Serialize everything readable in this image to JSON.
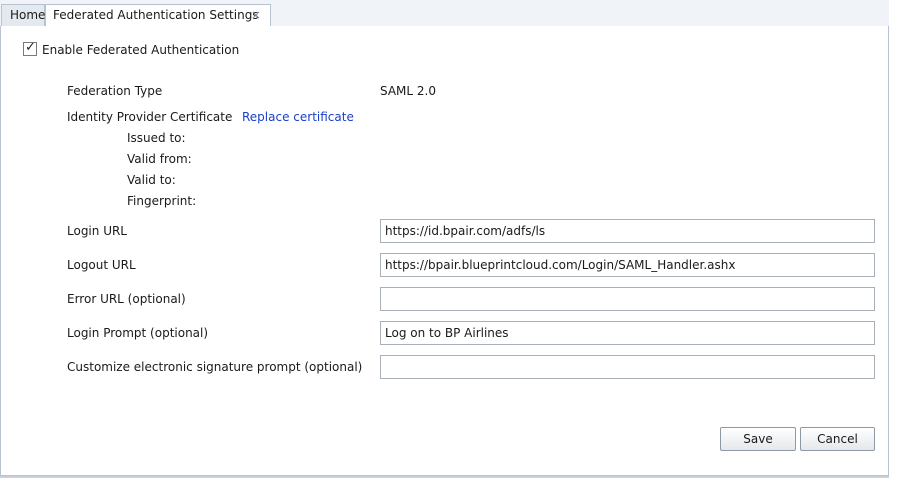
{
  "tabs": {
    "home_label": "Home",
    "active_label": "Federated Authentication Settings",
    "close_glyph": "×"
  },
  "enable": {
    "label": "Enable Federated Authentication",
    "checked": true,
    "check_glyph": "✓"
  },
  "federation_type": {
    "label": "Federation Type",
    "value": "SAML 2.0"
  },
  "certificate": {
    "label": "Identity Provider Certificate",
    "replace_link": "Replace certificate",
    "issued_to": "Issued to:",
    "valid_from": "Valid from:",
    "valid_to": "Valid to:",
    "fingerprint": "Fingerprint:"
  },
  "fields": {
    "login_url": {
      "label": "Login URL",
      "value": "https://id.bpair.com/adfs/ls"
    },
    "logout_url": {
      "label": "Logout URL",
      "value": "https://bpair.blueprintcloud.com/Login/SAML_Handler.ashx"
    },
    "error_url": {
      "label": "Error URL (optional)",
      "value": ""
    },
    "login_prompt": {
      "label": "Login Prompt (optional)",
      "value": "Log on to BP Airlines"
    },
    "esig_prompt": {
      "label": "Customize electronic signature prompt (optional)",
      "value": ""
    }
  },
  "buttons": {
    "save": "Save",
    "cancel": "Cancel"
  },
  "colors": {
    "link": "#1a3fc7",
    "border": "#b7c3d0"
  }
}
